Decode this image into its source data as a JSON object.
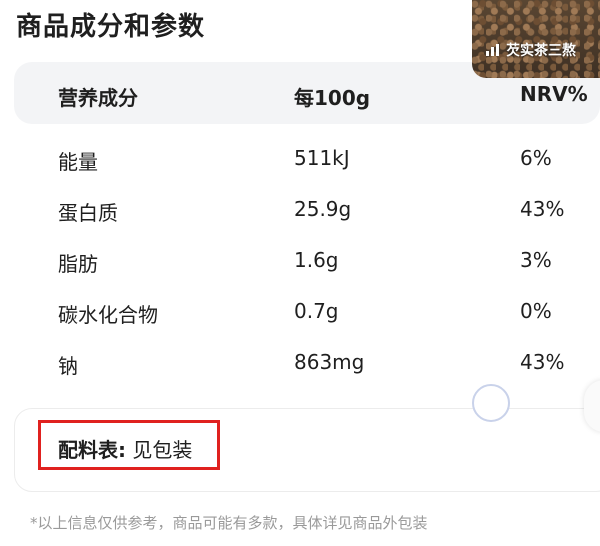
{
  "page_title": "商品成分和参数",
  "nutrition_table": {
    "headers": [
      "营养成分",
      "每100g",
      "NRV%"
    ],
    "rows": [
      [
        "能量",
        "511kJ",
        "6%"
      ],
      [
        "蛋白质",
        "25.9g",
        "43%"
      ],
      [
        "脂肪",
        "1.6g",
        "3%"
      ],
      [
        "碳水化合物",
        "0.7g",
        "0%"
      ],
      [
        "钠",
        "863mg",
        "43%"
      ]
    ]
  },
  "ingredients": {
    "label": "配料表:",
    "value": "见包装",
    "highlight_color": "#e0211f"
  },
  "disclaimer": "*以上信息仅供参考，商品可能有多款，具体详见商品外包装",
  "video_thumbnail": {
    "label": "芡实茶三熬",
    "icon": "signal-bars-icon"
  }
}
